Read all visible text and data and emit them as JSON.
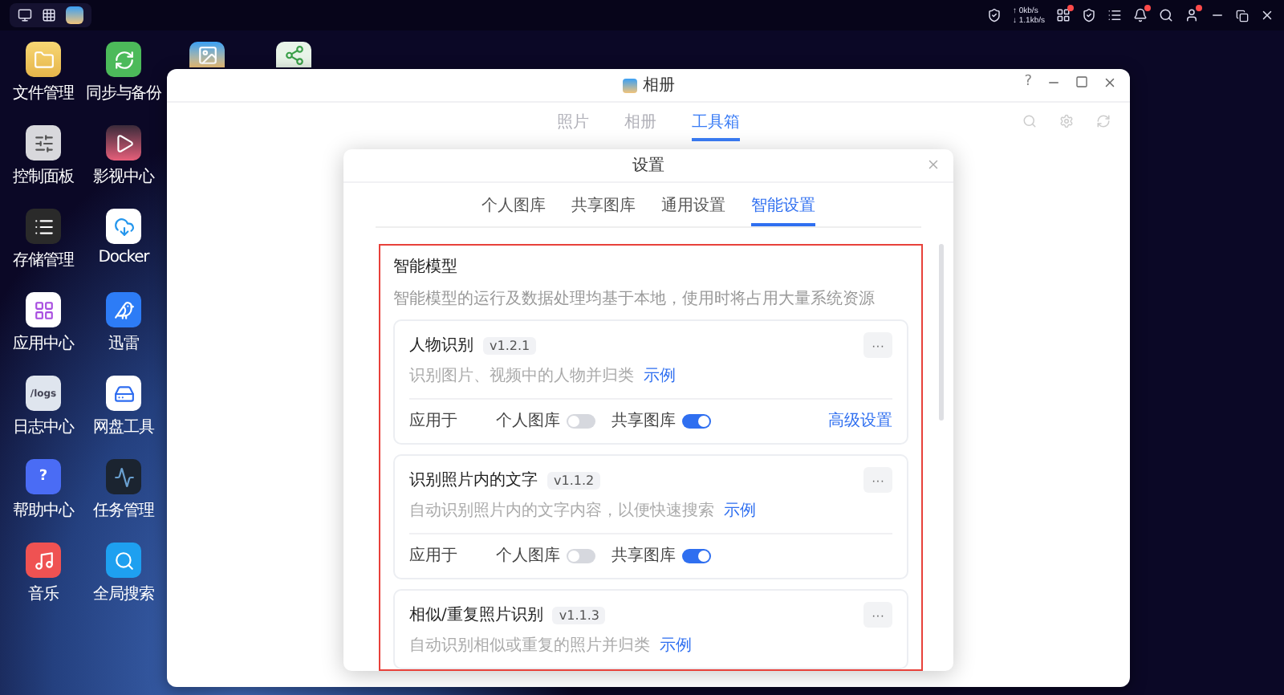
{
  "taskbar": {
    "net_up": "↑ 0kb/s",
    "net_down": "↓ 1.1kb/s"
  },
  "desktop_icons": [
    {
      "kind": "folder",
      "label": "文件管理"
    },
    {
      "kind": "sync",
      "label": "同步与备份"
    },
    {
      "kind": "photos"
    },
    {
      "kind": "share"
    },
    {
      "kind": "sliders",
      "label": "控制面板"
    },
    {
      "kind": "video",
      "label": "影视中心"
    },
    {
      "kind": "blank"
    },
    {
      "kind": "blank"
    },
    {
      "kind": "storage",
      "label": "存储管理"
    },
    {
      "kind": "docker",
      "label": "Docker"
    },
    {
      "kind": "blank"
    },
    {
      "kind": "blank"
    },
    {
      "kind": "apps",
      "label": "应用中心"
    },
    {
      "kind": "bird",
      "label": "迅雷"
    },
    {
      "kind": "blank"
    },
    {
      "kind": "blank"
    },
    {
      "kind": "logs",
      "label": "日志中心",
      "glyph": "/logs"
    },
    {
      "kind": "disk",
      "label": "网盘工具"
    },
    {
      "kind": "blank"
    },
    {
      "kind": "blank"
    },
    {
      "kind": "help",
      "label": "帮助中心",
      "glyph": "?"
    },
    {
      "kind": "monitor",
      "label": "任务管理"
    },
    {
      "kind": "blank"
    },
    {
      "kind": "blank"
    },
    {
      "kind": "music",
      "label": "音乐"
    },
    {
      "kind": "search",
      "label": "全局搜索"
    },
    {
      "kind": "blank"
    },
    {
      "kind": "blank"
    }
  ],
  "window": {
    "title": "相册",
    "tabs": [
      {
        "label": "照片",
        "selected": false
      },
      {
        "label": "相册",
        "selected": false
      },
      {
        "label": "工具箱",
        "selected": true
      }
    ],
    "help": "?"
  },
  "dialog": {
    "title": "设置",
    "tabs": [
      {
        "label": "个人图库",
        "selected": false
      },
      {
        "label": "共享图库",
        "selected": false
      },
      {
        "label": "通用设置",
        "selected": false
      },
      {
        "label": "智能设置",
        "selected": true
      }
    ],
    "section": {
      "title": "智能模型",
      "description": "智能模型的运行及数据处理均基于本地，使用时将占用大量系统资源",
      "models": [
        {
          "name": "人物识别",
          "version": "v1.2.1",
          "description": "识别图片、视频中的人物并归类",
          "example": "示例",
          "more": "···",
          "applies_label": "应用于",
          "toggles": [
            {
              "label": "个人图库",
              "on": false
            },
            {
              "label": "共享图库",
              "on": true
            }
          ],
          "advanced": "高级设置"
        },
        {
          "name": "识别照片内的文字",
          "version": "v1.1.2",
          "description": "自动识别照片内的文字内容，以便快速搜索",
          "example": "示例",
          "more": "···",
          "applies_label": "应用于",
          "toggles": [
            {
              "label": "个人图库",
              "on": false
            },
            {
              "label": "共享图库",
              "on": true
            }
          ]
        },
        {
          "name": "相似/重复照片识别",
          "version": "v1.1.3",
          "description": "自动识别相似或重复的照片并归类",
          "example": "示例",
          "more": "···"
        }
      ]
    }
  }
}
